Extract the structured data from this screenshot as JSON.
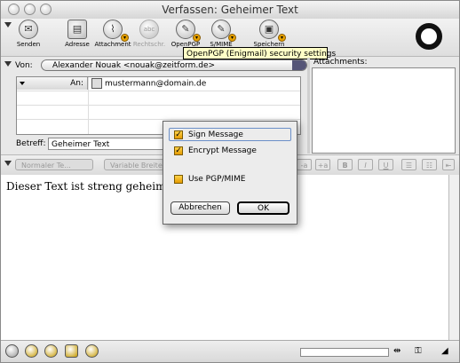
{
  "window": {
    "title": "Verfassen: Geheimer Text"
  },
  "toolbar": {
    "items": [
      {
        "label": "Senden",
        "glyph": "✉"
      },
      {
        "label": "Adresse",
        "glyph": "▤"
      },
      {
        "label": "Attachment",
        "glyph": "⌇"
      },
      {
        "label": "Rechtschr.",
        "glyph": "abc"
      },
      {
        "label": "OpenPGP",
        "glyph": "✎"
      },
      {
        "label": "S/MIME",
        "glyph": "✎"
      },
      {
        "label": "Speichern",
        "glyph": "▣"
      }
    ],
    "tooltip": "OpenPGP (Enigmail) security settings"
  },
  "header": {
    "from_label": "Von:",
    "from_value": "Alexander Nouak <nouak@zeitform.de>",
    "recipient_type": "An:",
    "recipient_value": "mustermann@domain.de",
    "subject_label": "Betreff:",
    "subject_value": "Geheimer Text",
    "attachments_label": "Attachments:"
  },
  "format_bar": {
    "paragraph_style": "Normaler Te...",
    "font": "Variable Breite"
  },
  "body": {
    "text": "Dieser Text  ist streng geheim!"
  },
  "dialog": {
    "sign_label": "Sign Message",
    "sign_checked": true,
    "encrypt_label": "Encrypt Message",
    "encrypt_checked": true,
    "pgpmime_label": "Use PGP/MIME",
    "pgpmime_checked": false,
    "cancel_label": "Abbrechen",
    "ok_label": "OK"
  },
  "colors": {
    "checkbox": "#f2b100",
    "tooltip": "#ffffc7",
    "focus": "#6b8fc8"
  }
}
